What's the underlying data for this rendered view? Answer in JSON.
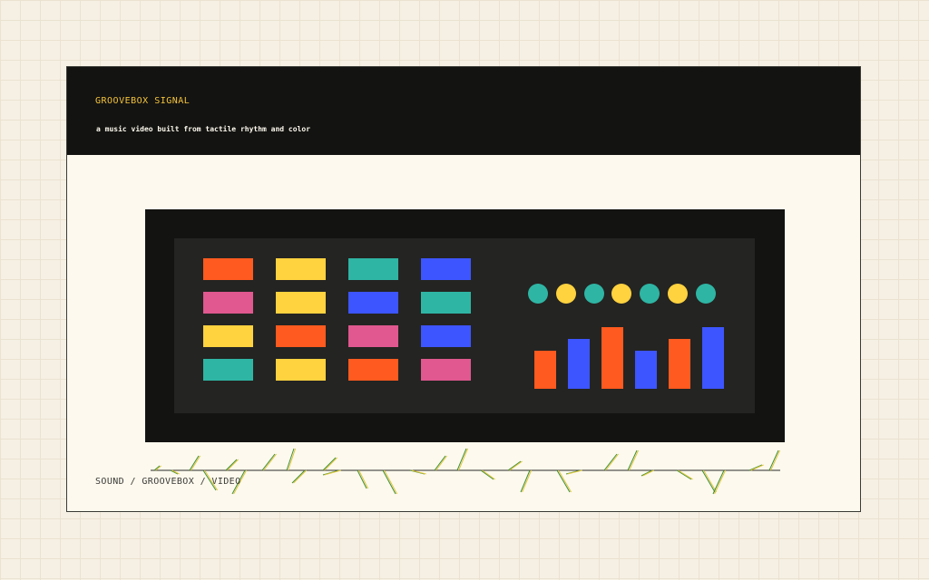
{
  "header": {
    "title": "GROOVEBOX SIGNAL",
    "subtitle": "a music video built from tactile rhythm and color"
  },
  "footer": {
    "label": "SOUND / GROOVEBOX / VIDEO"
  },
  "colors": {
    "page_bg": "#f6f0e4",
    "card_bg": "#fdf9ee",
    "dark": "#131311",
    "panel": "#242422",
    "accent_yellow": "#f5c43a",
    "orange": "#ff5a1f",
    "yellow": "#ffd23f",
    "teal": "#2fb5a4",
    "blue": "#3d55ff",
    "pink": "#e0588f"
  },
  "pads": [
    [
      "orange",
      "yellow",
      "teal",
      "blue"
    ],
    [
      "pink",
      "yellow",
      "blue",
      "teal"
    ],
    [
      "yellow",
      "orange",
      "pink",
      "blue"
    ],
    [
      "teal",
      "yellow",
      "orange",
      "pink"
    ]
  ],
  "leds": [
    "teal",
    "yellow",
    "teal",
    "yellow",
    "teal",
    "yellow",
    "teal"
  ],
  "meters": [
    {
      "color": "orange",
      "level": 0.58
    },
    {
      "color": "blue",
      "level": 0.77
    },
    {
      "color": "orange",
      "level": 0.94
    },
    {
      "color": "blue",
      "level": 0.58
    },
    {
      "color": "orange",
      "level": 0.77
    },
    {
      "color": "blue",
      "level": 0.94
    }
  ]
}
